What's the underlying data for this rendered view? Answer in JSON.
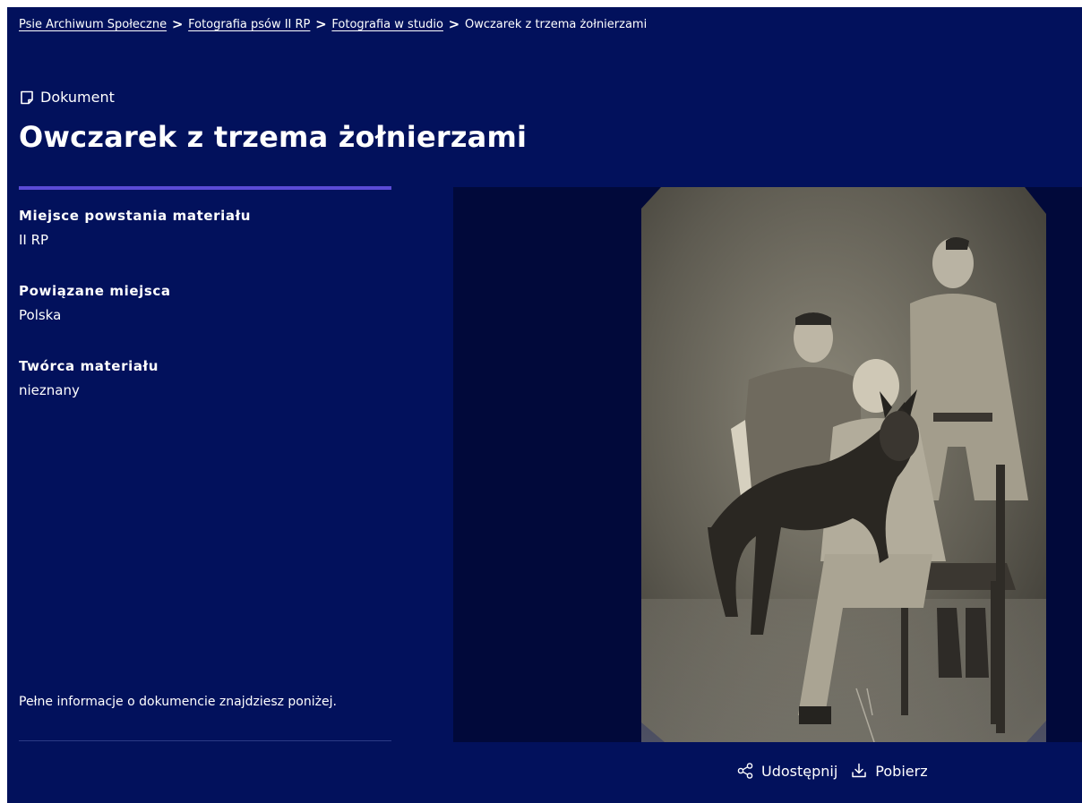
{
  "breadcrumb": {
    "items": [
      {
        "label": "Psie Archiwum Społeczne"
      },
      {
        "label": "Fotografia psów II RP"
      },
      {
        "label": "Fotografia w studio"
      }
    ],
    "current": "Owczarek z trzema żołnierzami",
    "separator": ">"
  },
  "document": {
    "type_label": "Dokument",
    "type_icon": "document-icon",
    "title": "Owczarek z trzema żołnierzami"
  },
  "metadata": [
    {
      "label": "Miejsce powstania materiału",
      "value": "II RP"
    },
    {
      "label": "Powiązane miejsca",
      "value": "Polska"
    },
    {
      "label": "Twórca materiału",
      "value": "nieznany"
    }
  ],
  "full_info_text": "Pełne informacje o dokumencie znajdziesz poniżej.",
  "actions": {
    "share": {
      "label": "Udostępnij",
      "icon": "share-icon"
    },
    "download": {
      "label": "Pobierz",
      "icon": "download-icon"
    }
  },
  "colors": {
    "background": "#02115c",
    "image_background": "#01093a",
    "accent": "#5a4bd6",
    "text": "#ffffff"
  }
}
